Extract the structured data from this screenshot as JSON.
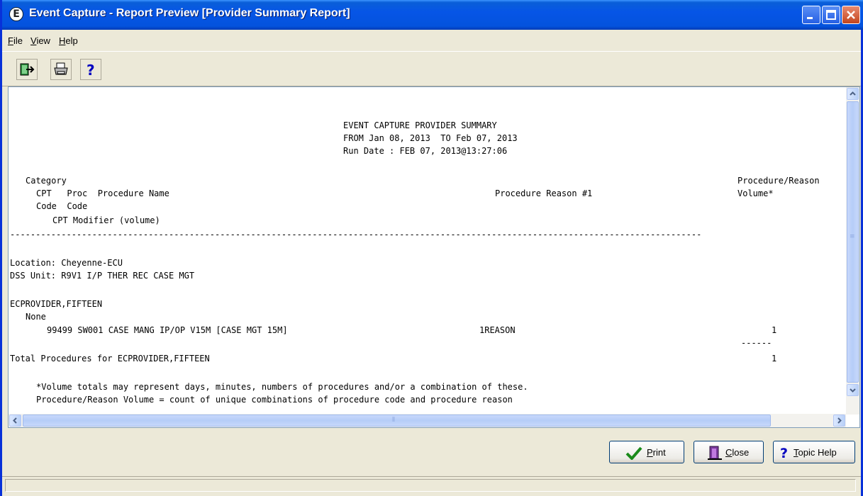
{
  "window": {
    "title": "Event Capture - Report Preview [Provider Summary Report]",
    "app_icon_glyph": "E",
    "controls": [
      "minimize",
      "maximize",
      "close"
    ]
  },
  "menu": {
    "items": [
      {
        "label": "File",
        "accel": "F",
        "rest": "ile"
      },
      {
        "label": "View",
        "accel": "V",
        "rest": "iew"
      },
      {
        "label": "Help",
        "accel": "H",
        "rest": "elp"
      }
    ]
  },
  "toolbar": {
    "buttons": [
      {
        "icon": "exit-icon"
      },
      {
        "icon": "printer-icon"
      },
      {
        "icon": "help-icon",
        "glyph": "?"
      }
    ]
  },
  "report": {
    "header_lines": [
      "EVENT CAPTURE PROVIDER SUMMARY",
      "FROM Jan 08, 2013  TO Feb 07, 2013",
      "Run Date : FEB 07, 2013@13:27:06"
    ],
    "col_category": "Category",
    "col_cpt_line": "CPT   Proc  Procedure Name",
    "col_code_line": "Code  Code",
    "col_modifier": "CPT Modifier (volume)",
    "col_reason": "Procedure Reason #1",
    "col_volume_1": "Procedure/Reason",
    "col_volume_2": "Volume*",
    "separator": "---------------------------------------------------------------------------------------------------------------------------------------",
    "location": "Location: Cheyenne-ECU",
    "dss_unit": "DSS Unit: R9V1 I/P THER REC CASE MGT",
    "provider": "ECPROVIDER,FIFTEEN",
    "category_value": "None",
    "procedure_line": "99499 SW001 CASE MANG IP/OP V15M [CASE MGT 15M]",
    "reason_value": "1REASON",
    "volume_value": "1",
    "volume_dashes": "------",
    "total_label": "Total Procedures for ECPROVIDER,FIFTEEN",
    "total_value": "1",
    "footnote_1": "*Volume totals may represent days, minutes, numbers of procedures and/or a combination of these.",
    "footnote_2": "Procedure/Reason Volume = count of unique combinations of procedure code and procedure reason"
  },
  "buttons": {
    "print": {
      "label": "Print",
      "accel": "P",
      "rest": "rint"
    },
    "close": {
      "label": "Close",
      "accel": "C",
      "rest": "lose"
    },
    "topic_help": {
      "label": "Topic Help",
      "accel": "T",
      "rest": "opic Help"
    }
  },
  "colors": {
    "title_bar": "#0655e6",
    "window_bg": "#ece9d8",
    "report_bg": "#ffffff"
  }
}
